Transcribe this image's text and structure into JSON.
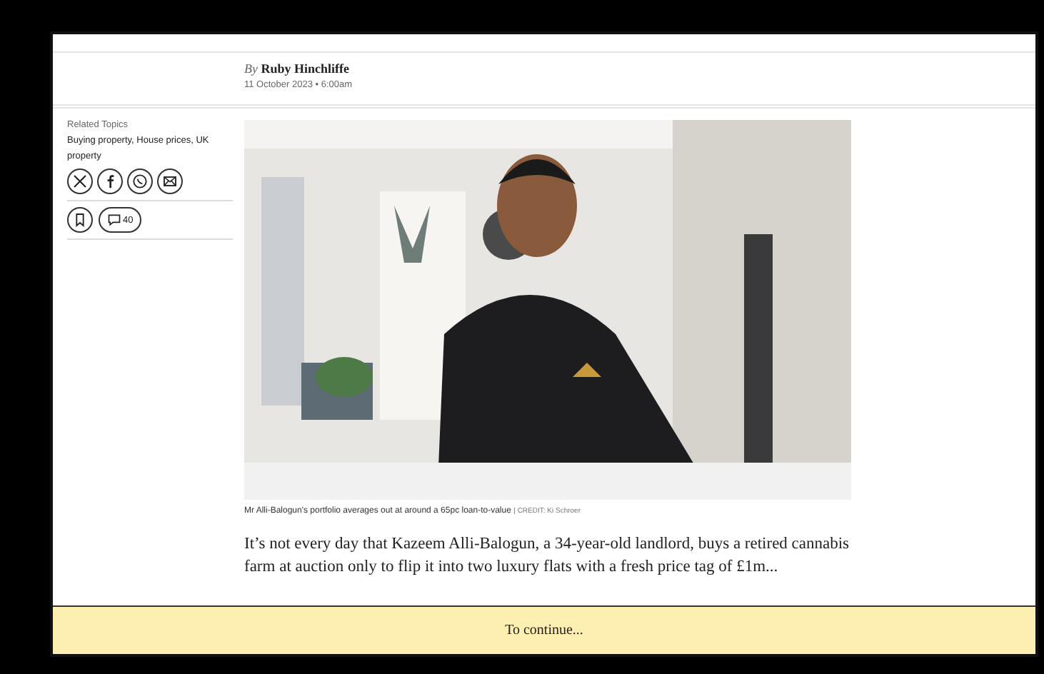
{
  "byline": {
    "prefix": "By",
    "author": "Ruby Hinchliffe",
    "date": "11 October 2023 • 6:00am"
  },
  "related_topics": {
    "heading": "Related Topics",
    "topics": "Buying property, House prices, UK property"
  },
  "share_buttons": [
    {
      "kind": "x"
    },
    {
      "kind": "facebook"
    },
    {
      "kind": "whatsapp"
    },
    {
      "kind": "email"
    }
  ],
  "actions": {
    "comment_count": "40"
  },
  "image": {
    "kind": "picture",
    "caption": "Mr Alli-Balogun's portfolio averages out at around a 65pc loan-to-value",
    "separator": "|",
    "credit": "CREDIT: Ki Schroer"
  },
  "paragraph": "It’s not every day that Kazeem Alli-Balogun, a 34-year-old landlord, buys a retired cannabis farm at auction only to flip it into two luxury flats with a fresh price tag of £1m...",
  "paywall": {
    "label": "To continue..."
  }
}
